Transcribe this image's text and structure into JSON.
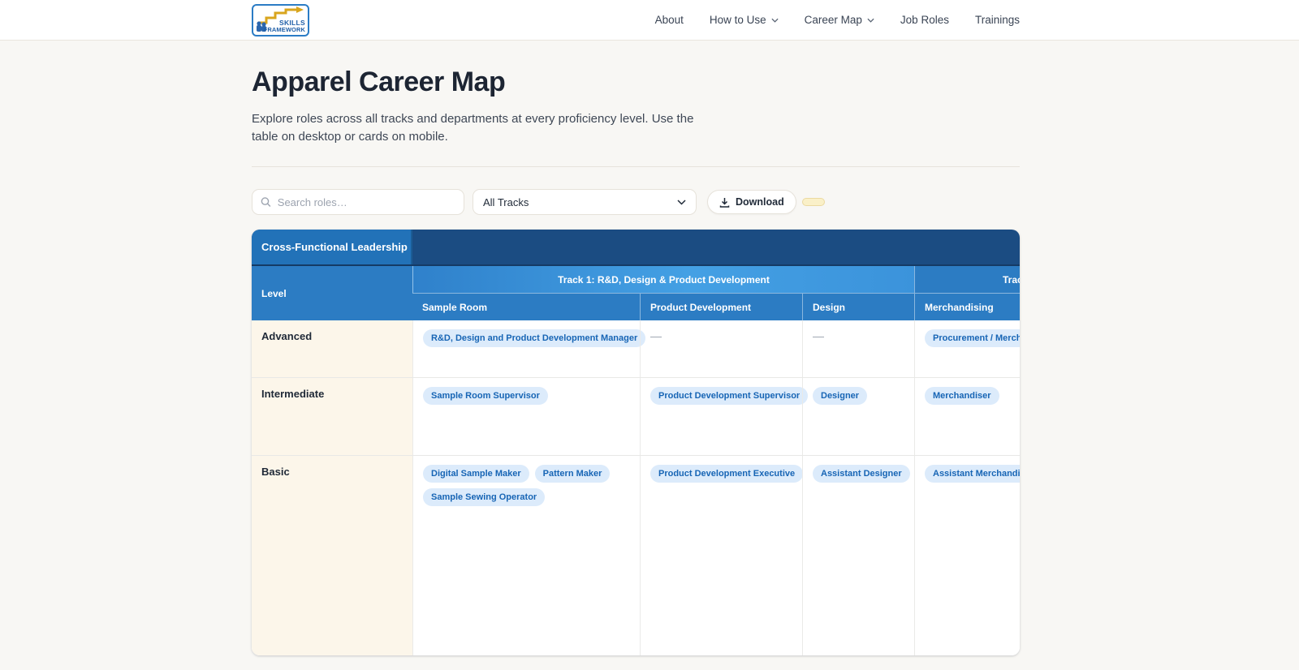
{
  "logo": {
    "line1": "SKILLS",
    "line2": "FRAMEWORK"
  },
  "nav": {
    "items": [
      {
        "label": "About",
        "has_dropdown": false
      },
      {
        "label": "How to Use",
        "has_dropdown": true
      },
      {
        "label": "Career Map",
        "has_dropdown": true
      },
      {
        "label": "Job Roles",
        "has_dropdown": false
      },
      {
        "label": "Trainings",
        "has_dropdown": false
      }
    ]
  },
  "page": {
    "title": "Apparel Career Map",
    "subtitle": "Explore roles across all tracks and departments at every proficiency level. Use the table on desktop or cards on mobile."
  },
  "controls": {
    "search_placeholder": "Search roles…",
    "search_value": "",
    "track_filter_value": "All Tracks",
    "download_label": "Download"
  },
  "table": {
    "corner_header": "Cross-Functional Leadership",
    "level_header": "Level",
    "track1_header": "Track 1: R&D, Design & Product Development",
    "track2_header_visible": "Trac",
    "departments": [
      "Sample Room",
      "Product Development",
      "Design",
      "Merchandising"
    ],
    "empty_marker": "—",
    "rows": [
      {
        "level": "Advanced",
        "cells": {
          "sample_room": [
            "R&D, Design and Product Development Manager"
          ],
          "product_development": [],
          "design": [],
          "merchandising": [
            "Procurement / Merchandisi"
          ]
        }
      },
      {
        "level": "Intermediate",
        "cells": {
          "sample_room": [
            "Sample Room Supervisor"
          ],
          "product_development": [
            "Product Development Supervisor"
          ],
          "design": [
            "Designer"
          ],
          "merchandising": [
            "Merchandiser"
          ]
        }
      },
      {
        "level": "Basic",
        "cells": {
          "sample_room": [
            "Digital Sample Maker",
            "Pattern Maker",
            "Sample Sewing Operator"
          ],
          "product_development": [
            "Product Development Executive"
          ],
          "design": [
            "Assistant Designer"
          ],
          "merchandising": [
            "Assistant Merchandiser"
          ]
        }
      }
    ]
  },
  "colors": {
    "band_navy": "#1B4C82",
    "corner_blue": "#2272B8",
    "header_blue": "#2C7CC3",
    "track1_blue": "#3E93DB",
    "pill_bg": "#DCEBFB",
    "pill_text": "#1765B5",
    "level_cream": "#FCF6EA",
    "page_bg": "#F8F7F4",
    "toggle_yellow": "#FAF0C8"
  }
}
